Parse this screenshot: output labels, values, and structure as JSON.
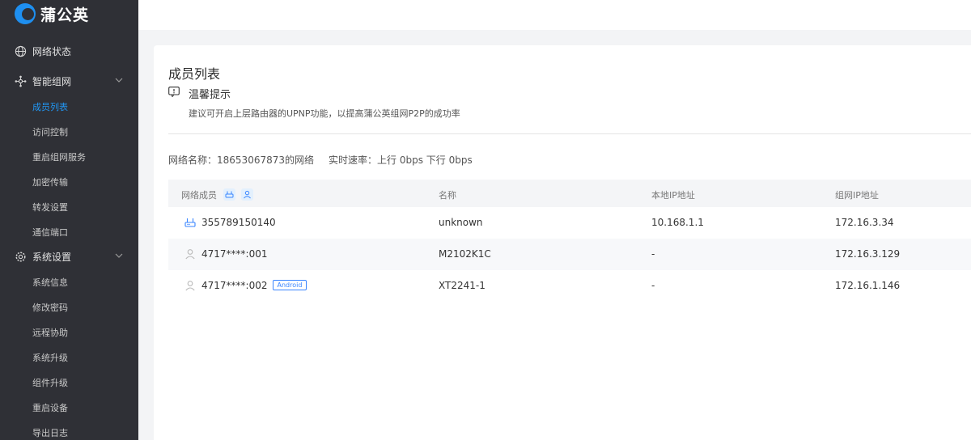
{
  "brand": {
    "name": "蒲公英"
  },
  "sidebar": {
    "groups": [
      {
        "label": "网络状态",
        "icon": "globe-icon",
        "items": []
      },
      {
        "label": "智能组网",
        "icon": "network-icon",
        "items": [
          {
            "label": "成员列表",
            "active": true
          },
          {
            "label": "访问控制"
          },
          {
            "label": "重启组网服务"
          },
          {
            "label": "加密传输"
          },
          {
            "label": "转发设置"
          },
          {
            "label": "通信端口"
          }
        ]
      },
      {
        "label": "系统设置",
        "icon": "gear-icon",
        "items": [
          {
            "label": "系统信息"
          },
          {
            "label": "修改密码"
          },
          {
            "label": "远程协助"
          },
          {
            "label": "系统升级"
          },
          {
            "label": "组件升级"
          },
          {
            "label": "重启设备"
          },
          {
            "label": "导出日志"
          }
        ]
      }
    ]
  },
  "page": {
    "title": "成员列表",
    "tip": {
      "title": "温馨提示",
      "text": "建议可开启上层路由器的UPNP功能，以提高蒲公英组网P2P的成功率"
    },
    "network": {
      "name_label": "网络名称：",
      "name_value": "18653067873的网络",
      "speed_label": "实时速率：",
      "speed_value": "上行 0bps 下行 0bps"
    }
  },
  "table": {
    "headers": [
      "网络成员",
      "名称",
      "本地IP地址",
      "组网IP地址"
    ],
    "rows": [
      {
        "icon": "router-icon",
        "member": "355789150140",
        "badge": "",
        "name": "unknown",
        "local_ip": "10.168.1.1",
        "vpn_ip": "172.16.3.34"
      },
      {
        "icon": "user-icon",
        "member": "4717****:001",
        "badge": "",
        "name": "M2102K1C",
        "local_ip": "-",
        "vpn_ip": "172.16.3.129"
      },
      {
        "icon": "user-icon",
        "member": "4717****:002",
        "badge": "Android",
        "name": "XT2241-1",
        "local_ip": "-",
        "vpn_ip": "172.16.1.146"
      }
    ]
  },
  "colors": {
    "accent": "#2196f3",
    "sidebar_bg": "#2f3036"
  }
}
